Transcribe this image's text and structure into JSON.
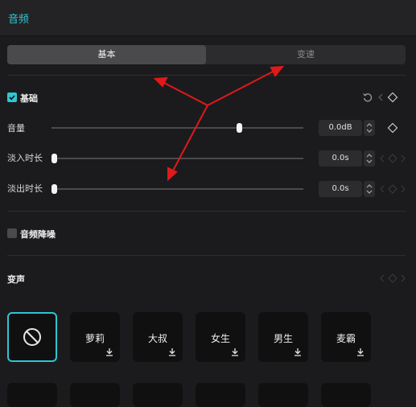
{
  "header": {
    "title": "音频"
  },
  "tabs": [
    {
      "label": "基本",
      "active": true
    },
    {
      "label": "变速",
      "active": false
    }
  ],
  "basic": {
    "title": "基础",
    "checked": true,
    "rows": [
      {
        "label": "音量",
        "value": "0.0dB",
        "level": 0.75
      },
      {
        "label": "淡入时长",
        "value": "0.0s",
        "level": 0.0
      },
      {
        "label": "淡出时长",
        "value": "0.0s",
        "level": 0.0
      }
    ]
  },
  "noise_reduction": {
    "label": "音频降噪",
    "checked": false
  },
  "voice_change": {
    "title": "变声",
    "presets": [
      {
        "name": "none",
        "label": "",
        "icon": "no-effect-icon",
        "selected": true
      },
      {
        "name": "loli",
        "label": "萝莉",
        "icon": "download-icon"
      },
      {
        "name": "uncle",
        "label": "大叔",
        "icon": "download-icon"
      },
      {
        "name": "female",
        "label": "女生",
        "icon": "download-icon"
      },
      {
        "name": "male",
        "label": "男生",
        "icon": "download-icon"
      },
      {
        "name": "mic-hog",
        "label": "麦霸",
        "icon": "download-icon"
      }
    ]
  },
  "colors": {
    "accent": "#2ec5d3",
    "annotation": "#e01919",
    "background": "#1b1b1d"
  }
}
